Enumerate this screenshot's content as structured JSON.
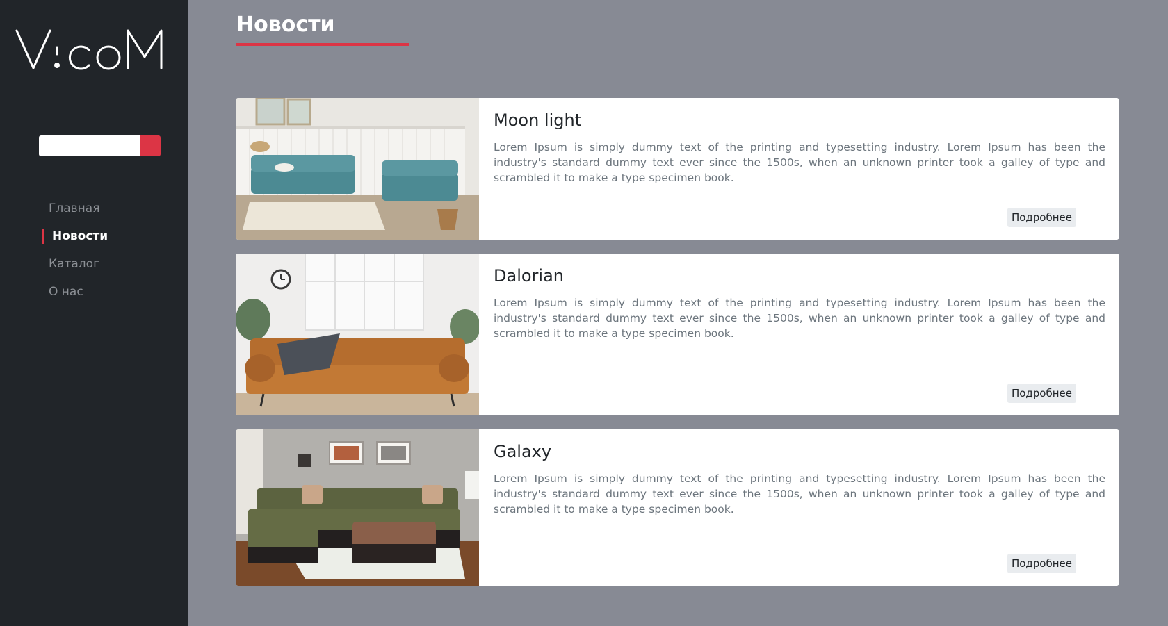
{
  "brand": {
    "logo_text": "VicoM"
  },
  "colors": {
    "sidebar": "#212529",
    "background": "#878a94",
    "accent": "#dc3545",
    "card": "#ffffff"
  },
  "search": {
    "placeholder": "",
    "value": ""
  },
  "nav": {
    "items": [
      {
        "label": "Главная",
        "active": false
      },
      {
        "label": "Новости",
        "active": true
      },
      {
        "label": "Каталог",
        "active": false
      },
      {
        "label": "О нас",
        "active": false
      }
    ]
  },
  "page": {
    "title": "Новости"
  },
  "news": [
    {
      "title": "Moon light",
      "text": "Lorem Ipsum is simply dummy text of the printing and typesetting industry. Lorem Ipsum has been the industry's standard dummy text ever since the 1500s, when an unknown printer took a galley of type and scrambled it to make a type specimen book.",
      "button": "Подробнее",
      "image": "teal-sofa-living-room"
    },
    {
      "title": "Dalorian",
      "text": "Lorem Ipsum is simply dummy text of the printing and typesetting industry. Lorem Ipsum has been the industry's standard dummy text ever since the 1500s, when an unknown printer took a galley of type and scrambled it to make a type specimen book.",
      "button": "Подробнее",
      "image": "leather-sofa-living-room"
    },
    {
      "title": "Galaxy",
      "text": "Lorem Ipsum is simply dummy text of the printing and typesetting industry. Lorem Ipsum has been the industry's standard dummy text ever since the 1500s, when an unknown printer took a galley of type and scrambled it to make a type specimen book.",
      "button": "Подробнее",
      "image": "olive-sectional-sofa-room"
    }
  ]
}
